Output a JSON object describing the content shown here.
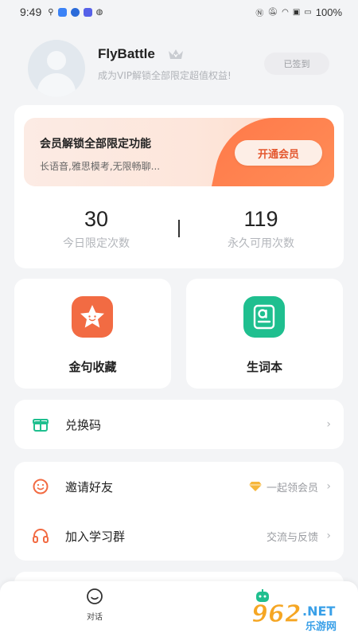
{
  "status_bar": {
    "time": "9:49",
    "battery": "100%"
  },
  "profile": {
    "username": "FlyBattle",
    "vip_tip": "成为VIP解锁全部限定超值权益!",
    "checkin_label": "已签到"
  },
  "vip_card": {
    "title": "会员解锁全部限定功能",
    "desc": "长语音,雅思模考,无限畅聊...",
    "open_button": "开通会员",
    "stats": [
      {
        "value": "30",
        "label": "今日限定次数"
      },
      {
        "value": "119",
        "label": "永久可用次数"
      }
    ]
  },
  "features": [
    {
      "label": "金句收藏",
      "icon": "star-icon",
      "color": "#f26b43"
    },
    {
      "label": "生词本",
      "icon": "vocabulary-book-icon",
      "color": "#1fbf8f"
    }
  ],
  "list": {
    "redeem": {
      "label": "兑换码",
      "icon": "gift-icon"
    },
    "invite": {
      "label": "邀请好友",
      "extra": "一起领会员",
      "icon": "smile-icon"
    },
    "group": {
      "label": "加入学习群",
      "extra": "交流与反馈",
      "icon": "headset-icon"
    }
  },
  "bottom_nav": {
    "chat_label": "对话"
  },
  "watermark": {
    "number": "962",
    "suffix": ".NET",
    "sub": "乐游网"
  },
  "colors": {
    "accent_orange": "#ff7a4a",
    "accent_green": "#1fbf8f",
    "gift_green": "#1fbf8f",
    "invite_orange": "#f26b43"
  }
}
